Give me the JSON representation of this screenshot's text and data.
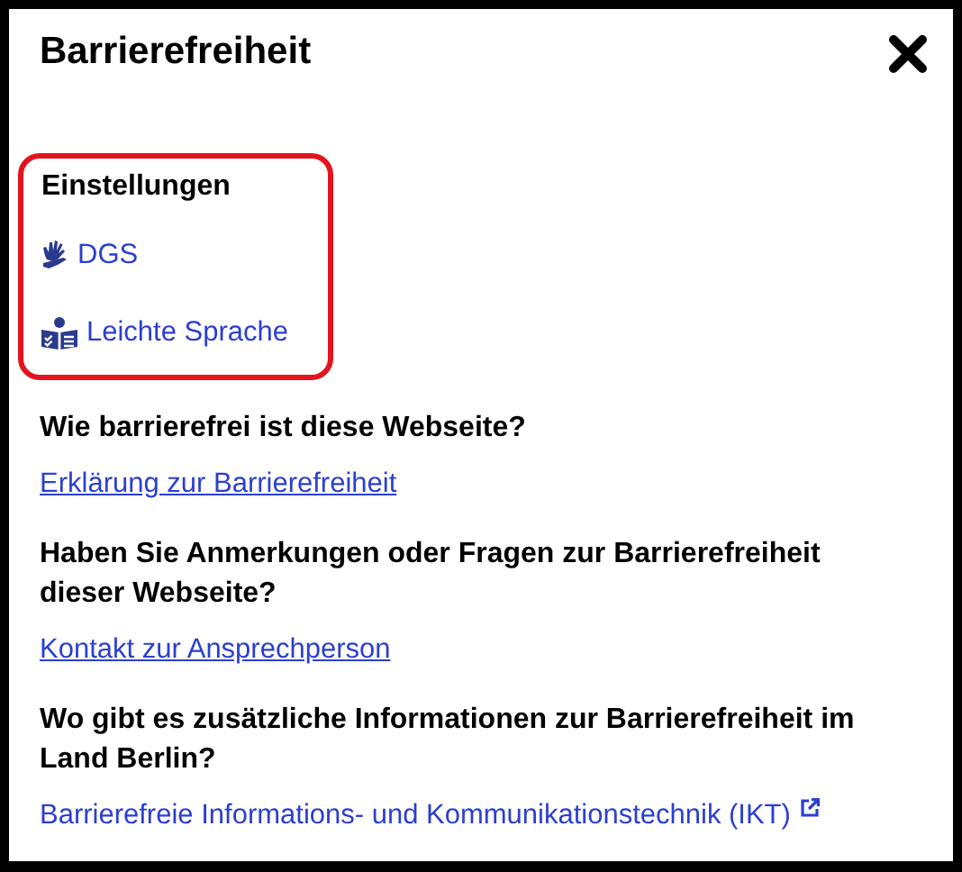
{
  "title": "Barrierefreiheit",
  "settings": {
    "heading": "Einstellungen",
    "items": [
      {
        "label": "DGS",
        "kind": "sign-language"
      },
      {
        "label": "Leichte Sprache",
        "kind": "easy-language"
      }
    ]
  },
  "sections": [
    {
      "heading": "Wie barrierefrei ist diese Webseite?",
      "link": "Erklärung zur Barrierefreiheit",
      "external": false
    },
    {
      "heading": "Haben Sie Anmerkungen oder Fragen zur Barrierefreiheit dieser Webseite?",
      "link": "Kontakt zur Ansprechperson",
      "external": false
    },
    {
      "heading": "Wo gibt es zusätzliche Informationen zur Barrierefreiheit im Land Berlin?",
      "link": "Barrierefreie Informations- und Kommunikationstechnik (IKT)",
      "external": true
    }
  ]
}
